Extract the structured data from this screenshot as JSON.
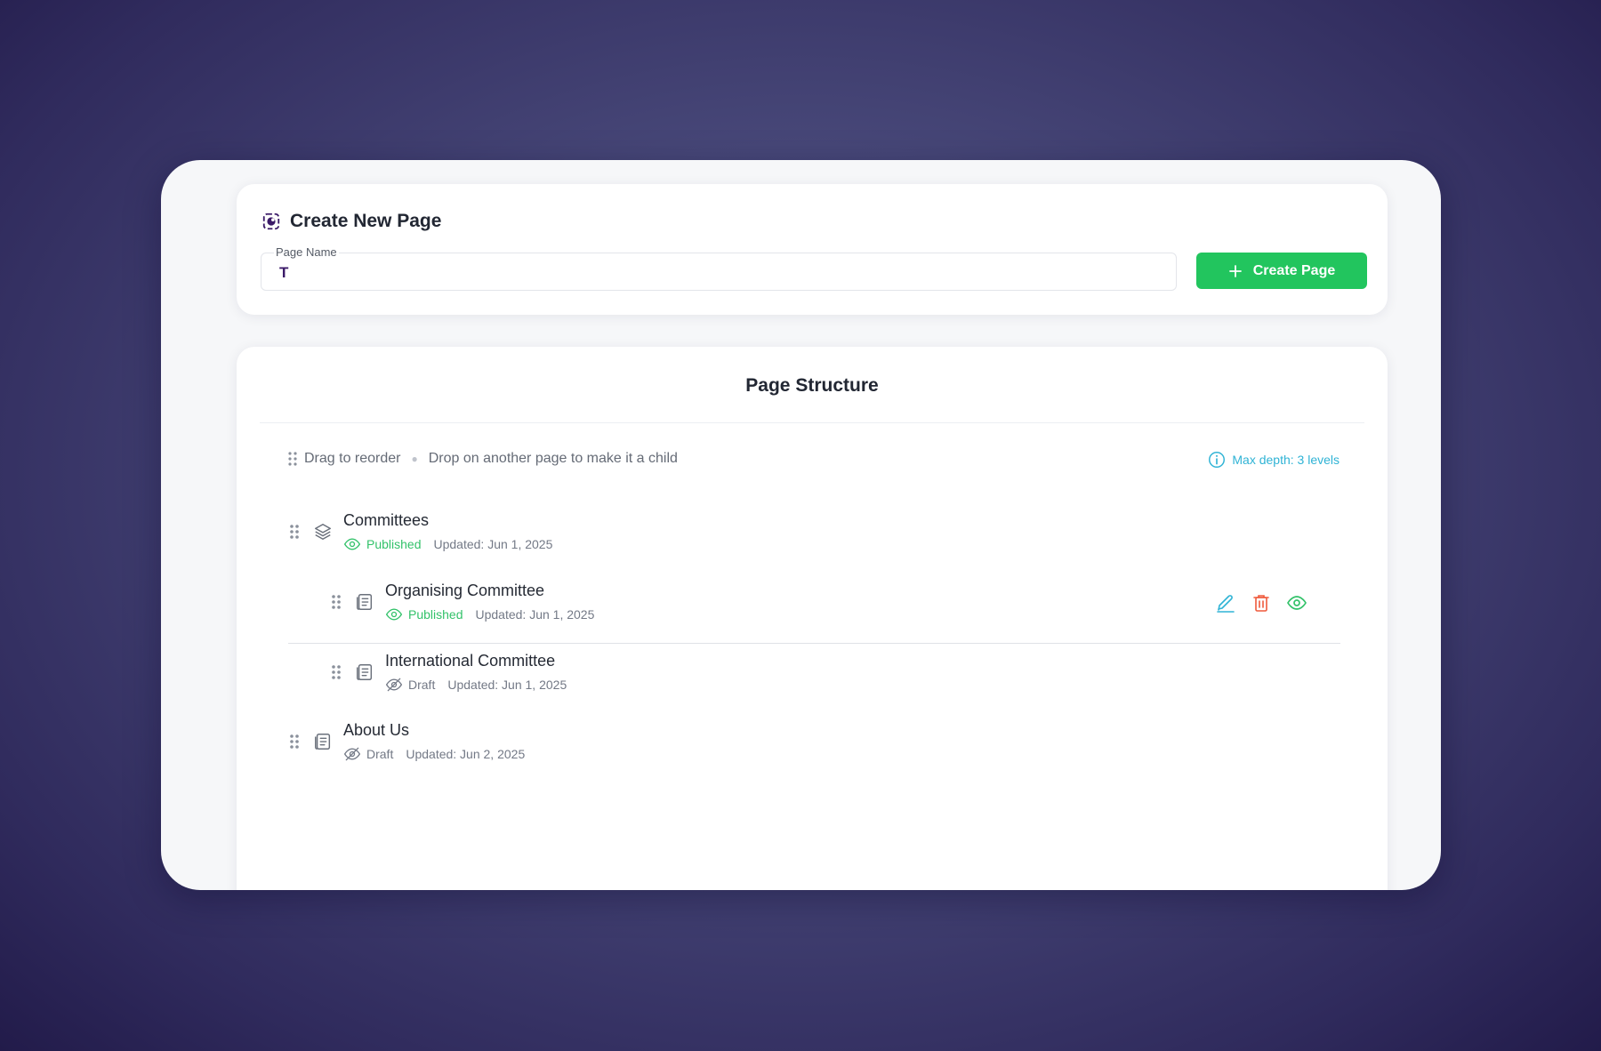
{
  "create_page": {
    "title": "Create New Page",
    "field_label": "Page Name",
    "field_value": "T",
    "button_label": "Create Page"
  },
  "structure": {
    "title": "Page Structure",
    "hint_drag": "Drag to reorder",
    "hint_drop": "Drop on another page to make it a child",
    "max_depth": "Max depth: 3 levels",
    "pages": [
      {
        "name": "Committees",
        "status": "Published",
        "updated": "Updated: Jun 1, 2025",
        "icon": "layers-icon"
      },
      {
        "name": "Organising Committee",
        "status": "Published",
        "updated": "Updated: Jun 1, 2025",
        "icon": "document-icon"
      },
      {
        "name": "International Committee",
        "status": "Draft",
        "updated": "Updated: Jun 1, 2025",
        "icon": "document-icon"
      },
      {
        "name": "About Us",
        "status": "Draft",
        "updated": "Updated: Jun 2, 2025",
        "icon": "document-icon"
      }
    ]
  },
  "colors": {
    "accent_green": "#22c55e",
    "published": "#33c26a",
    "info": "#2fb3d5",
    "edit": "#2fb3d5",
    "delete": "#ef5a3c",
    "view": "#33c26a"
  }
}
